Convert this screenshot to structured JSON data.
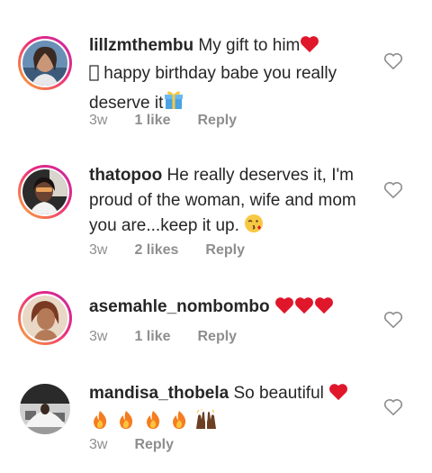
{
  "comments": [
    {
      "username": "lillzmthembu",
      "text_1": "My gift to him",
      "text_2": "happy birthday babe you really deserve it",
      "time": "3w",
      "likes": "1 like",
      "reply": "Reply",
      "avatar_icon": "woman-avatar"
    },
    {
      "username": "thatopoo",
      "text_1": "He really deserves it, I'm proud of the woman, wife and mom you are...keep it up.",
      "time": "3w",
      "likes": "2 likes",
      "reply": "Reply",
      "avatar_icon": "woman-in-car-avatar"
    },
    {
      "username": "asemahle_nombombo",
      "text_1": "",
      "time": "3w",
      "likes": "1 like",
      "reply": "Reply",
      "avatar_icon": "woman-portrait-avatar"
    },
    {
      "username": "mandisa_thobela",
      "text_1": "So beautiful",
      "time": "3w",
      "likes": "",
      "reply": "Reply",
      "avatar_icon": "person-outdoors-avatar"
    }
  ],
  "colors": {
    "text": "#262626",
    "meta": "#8e8e8e",
    "heart": "#e0162b",
    "ring_start": "#f9b233",
    "ring_end": "#c32aa3"
  },
  "icons": {
    "like": "heart-outline-icon",
    "heart_emoji": "red-heart-emoji",
    "gift_emoji": "gift-emoji",
    "kiss_emoji": "face-blowing-kiss-emoji",
    "fire_emoji": "fire-emoji",
    "hands_emoji": "raising-hands-emoji"
  }
}
